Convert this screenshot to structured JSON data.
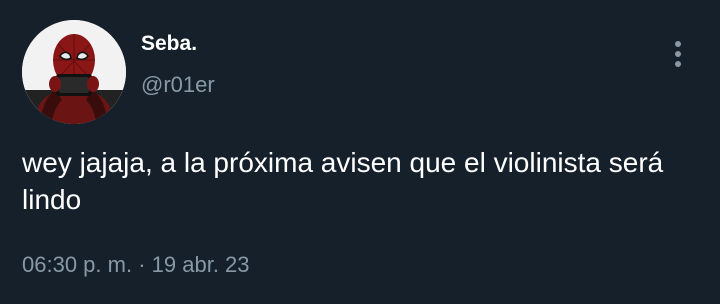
{
  "user": {
    "display_name": "Seba.",
    "handle": "@r01er",
    "avatar_icon": "avatar-spiderman-mask"
  },
  "tweet": {
    "text": "wey jajaja, a la próxima avisen que el violinista será lindo",
    "time": "06:30 p. m.",
    "separator": "·",
    "date": "19 abr. 23"
  },
  "menu": {
    "icon": "more-vertical-icon"
  },
  "colors": {
    "background": "#15202b",
    "primary_text": "#ffffff",
    "secondary_text": "#8899a6"
  }
}
